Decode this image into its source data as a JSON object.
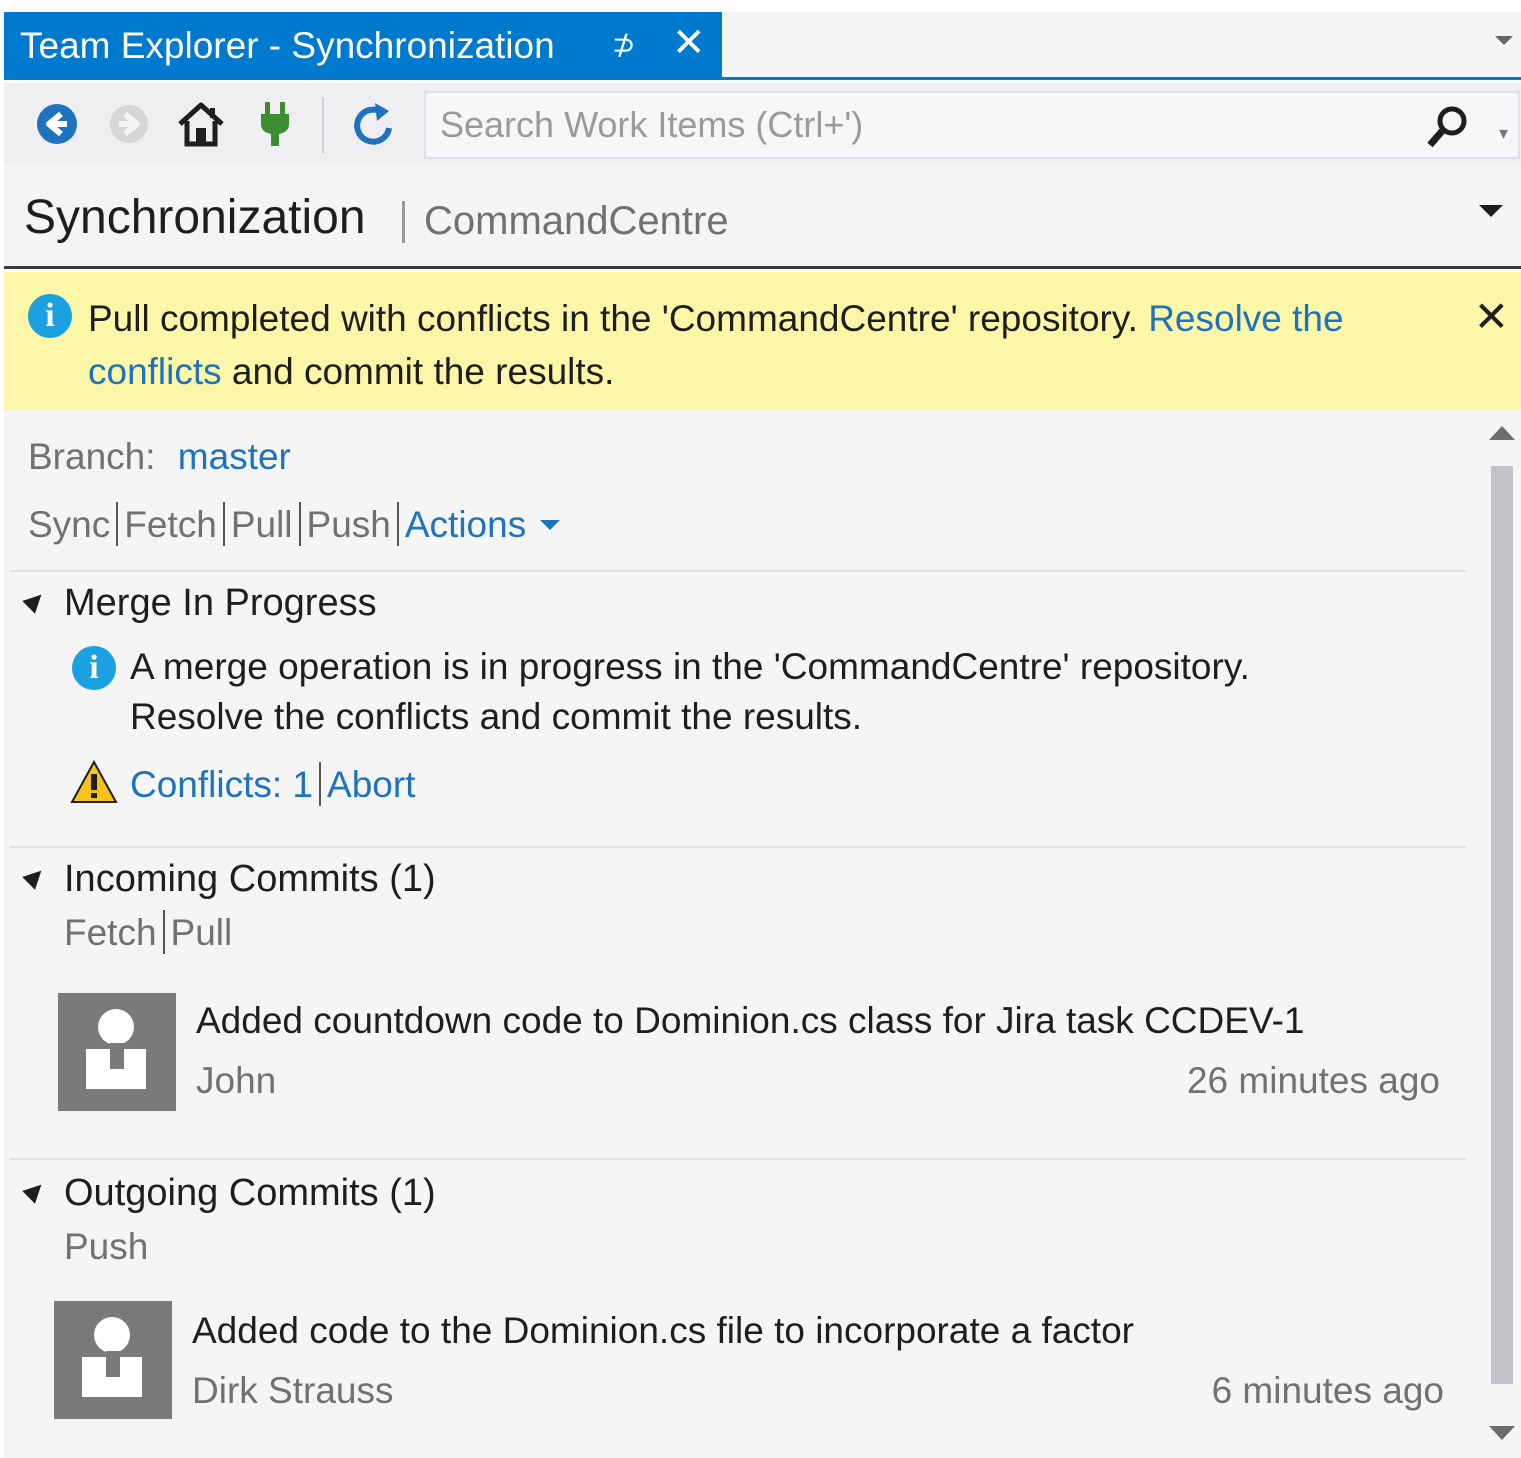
{
  "window": {
    "tab_title": "Team Explorer - Synchronization",
    "pin_glyph": "⊅",
    "close_glyph": "✕"
  },
  "toolbar": {
    "search_placeholder": "Search Work Items (Ctrl+')",
    "search_drop_glyph": "▾"
  },
  "header": {
    "title": "Synchronization",
    "subtitle": "CommandCentre"
  },
  "notification": {
    "text_before": "Pull completed with conflicts in the 'CommandCentre' repository. ",
    "link": "Resolve the conflicts",
    "text_after": " and commit the results.",
    "close_glyph": "✕"
  },
  "branch": {
    "label": "Branch:",
    "value": "master"
  },
  "actions": {
    "items": [
      "Sync",
      "Fetch",
      "Pull",
      "Push"
    ],
    "dropdown_label": "Actions"
  },
  "merge_section": {
    "title": "Merge In Progress",
    "message_line1": "A merge operation is in progress in the 'CommandCentre' repository.",
    "message_line2": "Resolve the conflicts and commit the results.",
    "conflicts_link": "Conflicts: 1",
    "abort_link": "Abort"
  },
  "incoming_section": {
    "title": "Incoming Commits (1)",
    "links": [
      "Fetch",
      "Pull"
    ],
    "commits": [
      {
        "message": "Added countdown code to Dominion.cs class for Jira task CCDEV-1",
        "author": "John",
        "time": "26 minutes ago"
      }
    ]
  },
  "outgoing_section": {
    "title": "Outgoing Commits (1)",
    "links": [
      "Push"
    ],
    "commits": [
      {
        "message": "Added code to the Dominion.cs file to incorporate a factor",
        "author": "Dirk Strauss",
        "time": "6 minutes ago"
      }
    ]
  },
  "colors": {
    "accent": "#007acc",
    "link": "#1e73be",
    "notification_bg": "#fbf6a8",
    "info_blue": "#1ba1e2",
    "connect_green": "#3c8d2f"
  }
}
